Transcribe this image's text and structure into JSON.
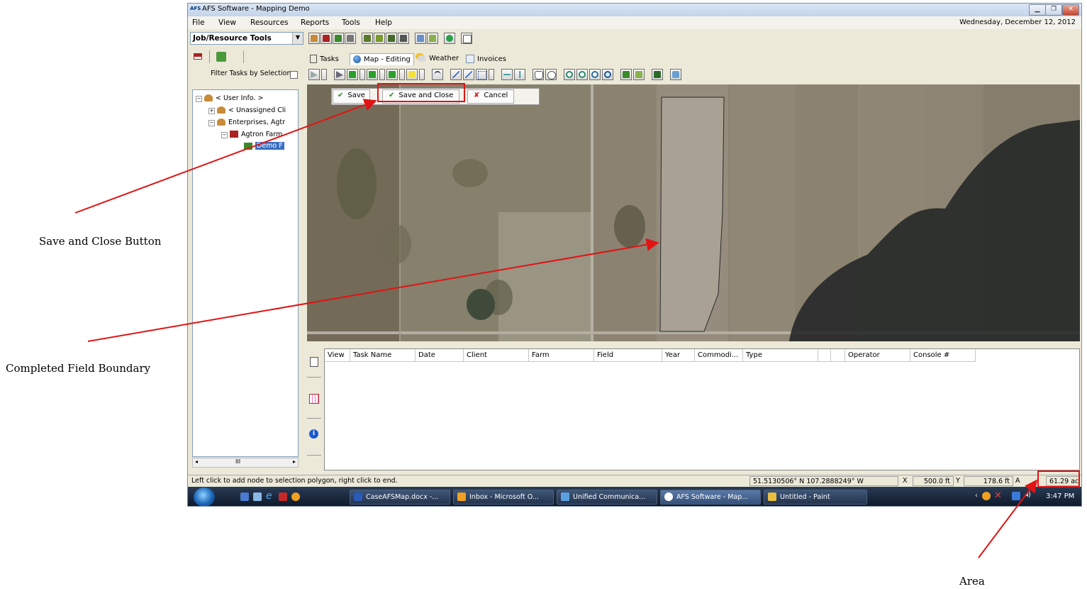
{
  "window": {
    "logo": "AFS",
    "title": "AFS Software - Mapping Demo",
    "controls": [
      "minimize",
      "maximize",
      "close"
    ]
  },
  "menubar": {
    "items": [
      "File",
      "View",
      "Resources",
      "Reports",
      "Tools",
      "Help"
    ],
    "date": "Wednesday, December 12, 2012"
  },
  "toolbar": {
    "selector_value": "Job/Resource Tools"
  },
  "left_panel": {
    "filter_label": "Filter Tasks by Selection",
    "tree": [
      {
        "label": "< User Info. >",
        "level": 0
      },
      {
        "label": "< Unassigned Cli",
        "level": 1
      },
      {
        "label": "Enterprises, Agtr",
        "level": 1
      },
      {
        "label": "Agtron Farm",
        "level": 2
      },
      {
        "label": "Demo F",
        "level": 3,
        "selected": true
      }
    ],
    "scroll_label": "III"
  },
  "tabs": [
    {
      "label": "Tasks",
      "icon": "task-list-icon"
    },
    {
      "label": "Map - Editing",
      "icon": "globe-icon",
      "active": true
    },
    {
      "label": "Weather",
      "icon": "weather-icon"
    },
    {
      "label": "Invoices",
      "icon": "invoice-icon"
    }
  ],
  "edit_popup": {
    "save": "Save",
    "save_close": "Save and Close",
    "cancel": "Cancel"
  },
  "grid": {
    "columns": [
      "View",
      "Task Name",
      "Date",
      "Client",
      "Farm",
      "Field",
      "Year",
      "Commodi...",
      "Type",
      "",
      "",
      "Operator",
      "Console #"
    ]
  },
  "status": {
    "message": "Left click to add node to selection polygon, right click to end.",
    "coords": "51.5130506° N  107.2888249° W",
    "x_label": "X",
    "x_value": "500.0 ft",
    "y_label": "Y",
    "y_value": "178.6 ft",
    "a_label": "A",
    "area": "61.29 ac"
  },
  "taskbar": {
    "items": [
      "CaseAFSMap.docx -...",
      "Inbox - Microsoft O...",
      "Unified Communica...",
      "AFS Software - Map...",
      "Untitled - Paint"
    ],
    "time": "3:47 PM"
  },
  "annotations": {
    "save_close": "Save and Close Button",
    "boundary": "Completed Field Boundary",
    "area": "Area"
  },
  "colors": {
    "annotation_red": "#e01414",
    "selection_blue": "#3a6fc4",
    "window_chrome": "#ece9d8"
  }
}
